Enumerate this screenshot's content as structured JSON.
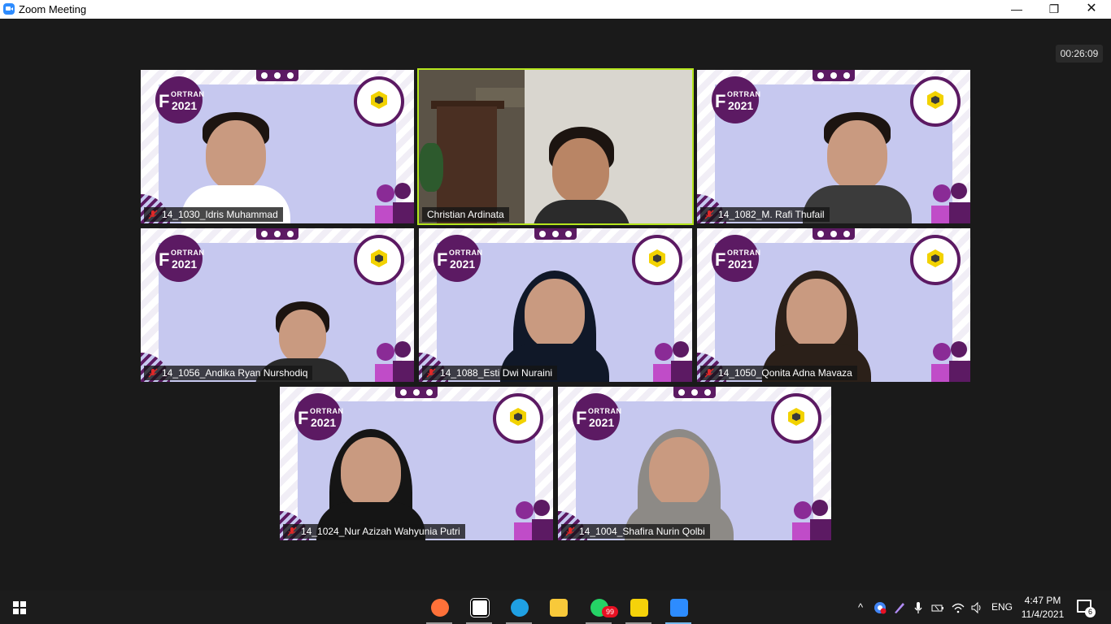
{
  "window": {
    "title": "Zoom Meeting",
    "minimize": "—",
    "restore": "❐",
    "close": "✕"
  },
  "meeting": {
    "timer": "00:26:09",
    "tiles": [
      {
        "name": "14_1030_Idris Muhammad",
        "muted": true,
        "active": false,
        "logo": "ORTRAN",
        "year": "2021"
      },
      {
        "name": "Christian Ardinata",
        "muted": false,
        "active": true
      },
      {
        "name": "14_1082_M. Rafi Thufail",
        "muted": true,
        "active": false,
        "logo": "ORTRAN",
        "year": "2021"
      },
      {
        "name": "14_1056_Andika Ryan Nurshodiq",
        "muted": true,
        "active": false,
        "logo": "ORTRAN",
        "year": "2021"
      },
      {
        "name": "14_1088_Esti Dwi Nuraini",
        "muted": true,
        "active": false,
        "logo": "ORTRAN",
        "year": "2021"
      },
      {
        "name": "14_1050_Qonita Adna Mavaza",
        "muted": true,
        "active": false,
        "logo": "ORTRAN",
        "year": "2021"
      },
      {
        "name": "14_1024_Nur Azizah Wahyunia Putri",
        "muted": true,
        "active": false,
        "logo": "ORTRAN",
        "year": "2021"
      },
      {
        "name": "14_1004_Shafira Nurin Qolbi",
        "muted": true,
        "active": false,
        "logo": "ORTRAN",
        "year": "2021"
      }
    ]
  },
  "taskbar": {
    "apps": [
      {
        "icon": "firefox-icon",
        "color": "#ff7139",
        "running": true
      },
      {
        "icon": "notion-icon",
        "color": "#ffffff",
        "running": true
      },
      {
        "icon": "edge-icon",
        "color": "#1fa0e3",
        "running": true
      },
      {
        "icon": "file-explorer-icon",
        "color": "#f8c93a",
        "running": false
      },
      {
        "icon": "whatsapp-icon",
        "color": "#25d366",
        "running": true,
        "badge": "99"
      },
      {
        "icon": "sticky-notes-icon",
        "color": "#f5d20a",
        "running": true
      },
      {
        "icon": "zoom-icon",
        "color": "#2d8cff",
        "running": true,
        "active": true
      }
    ],
    "tray": {
      "chevron": "^",
      "lang": "ENG",
      "time": "4:47 PM",
      "date": "11/4/2021",
      "notifications": "6"
    }
  }
}
